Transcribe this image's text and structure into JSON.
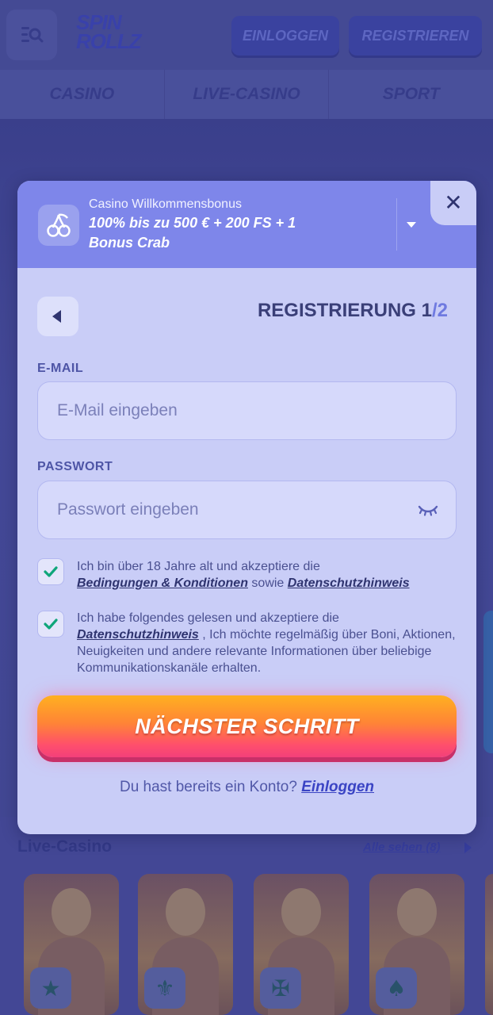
{
  "header": {
    "logo_line1": "SPIN",
    "logo_line2": "ROLLZ",
    "login_label": "EINLOGGEN",
    "register_label": "REGISTRIEREN"
  },
  "nav": {
    "items": [
      {
        "label": "CASINO"
      },
      {
        "label": "LIVE-CASINO"
      },
      {
        "label": "SPORT"
      }
    ]
  },
  "section": {
    "title": "Live-Casino",
    "see_all": "Alle sehen (8)"
  },
  "modal": {
    "bonus": {
      "subtitle": "Casino Willkommensbonus",
      "title": "100% bis zu 500 € + 200 FS + 1 Bonus Crab"
    },
    "close_label": "✕",
    "step_title": "REGISTRIERUNG 1",
    "step_total": "/2",
    "email": {
      "label": "E-MAIL",
      "placeholder": "E-Mail eingeben"
    },
    "password": {
      "label": "PASSWORT",
      "placeholder": "Passwort eingeben"
    },
    "consent1": {
      "text": "Ich bin über 18 Jahre alt und akzeptiere die",
      "link1": "Bedingungen & Konditionen",
      "joiner": "sowie",
      "link2": "Datenschutzhinweis",
      "checked": true
    },
    "consent2": {
      "text": "Ich habe folgendes gelesen und akzeptiere die",
      "link": "Datenschutzhinweis",
      "rest": ", Ich möchte regelmäßig über Boni, Aktionen, Neuigkeiten und andere relevante Informationen über beliebige Kommunikationskanäle erhalten.",
      "checked": true
    },
    "cta_label": "NÄCHSTER SCHRITT",
    "login_prompt": "Du hast bereits ein Konto?",
    "login_link": "Einloggen"
  },
  "colors": {
    "modal_bg": "#c9cdf7",
    "bonus_bar": "#7e86ea",
    "accent_text": "#2f3470",
    "cta_top": "#ffb020",
    "cta_bottom": "#f3407a",
    "check": "#0fa67a"
  },
  "icons": {
    "menu": "menu-search-icon",
    "bonus": "cherry-icon",
    "close": "close-icon",
    "back": "back-arrow-icon",
    "eye": "eye-closed-icon",
    "check": "checkmark-icon"
  }
}
